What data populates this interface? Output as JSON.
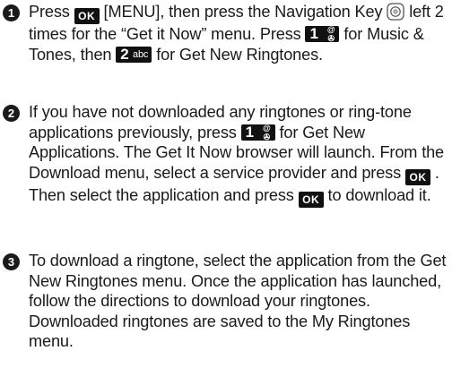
{
  "keys": {
    "ok": "OK",
    "key1_digit": "1",
    "key1_sub": "@\n&#9991;",
    "key2_digit": "2",
    "key2_sub": "abc"
  },
  "step1": {
    "number": "1",
    "t1": "Press ",
    "t2": " [MENU], then press the Navigation Key ",
    "t3": " left 2 times for the “Get it Now” menu. Press ",
    "t4": " for Music & Tones, then ",
    "t5": " for Get New Ringtones."
  },
  "step2": {
    "number": "2",
    "t1": "If you have not downloaded any ringtones or ring-tone applications previously, press ",
    "t2": " for Get New Applications. The Get It Now browser will launch. From the Download menu, select a service provider and press ",
    "t3": " . Then select the application and press ",
    "t4": " to download it."
  },
  "step3": {
    "number": "3",
    "text": "To download a ringtone, select the application from the Get New Ringtones menu. Once the application has launched, follow the directions to download your ringtones. Downloaded ringtones are saved to the My Ringtones menu."
  }
}
